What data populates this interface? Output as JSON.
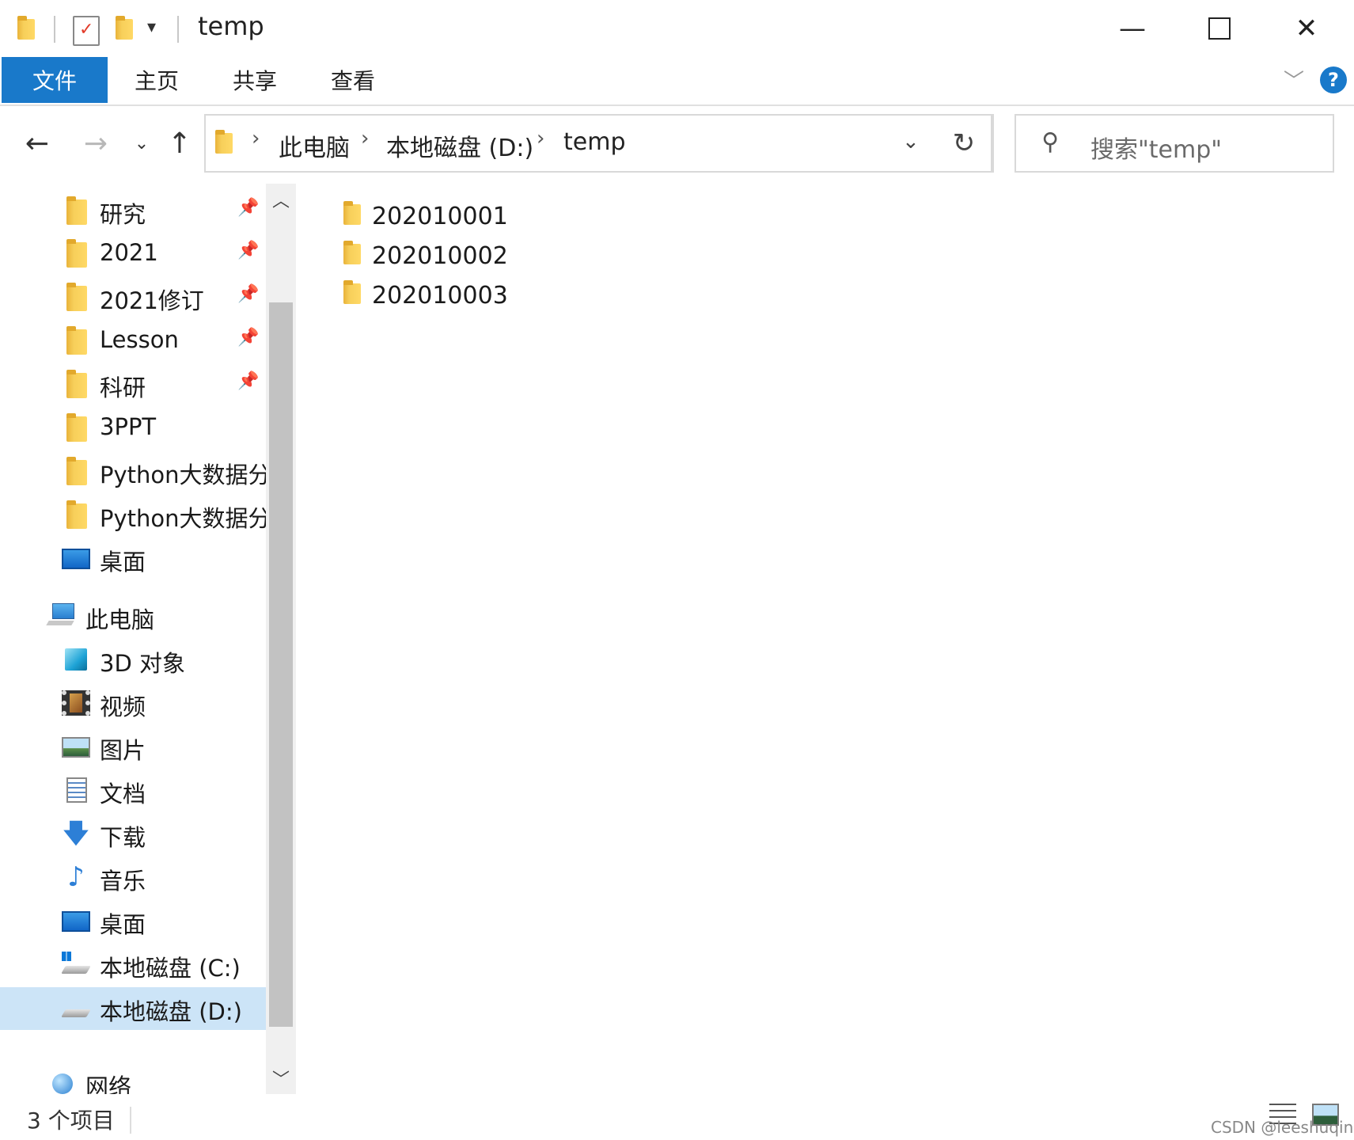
{
  "window": {
    "title": "temp",
    "minimize_glyph": "—",
    "maximize_glyph": "☐",
    "close_glyph": "✕"
  },
  "ribbon": {
    "tabs": [
      "文件",
      "主页",
      "共享",
      "查看"
    ],
    "help_glyph": "?"
  },
  "address": {
    "crumbs": [
      "此电脑",
      "本地磁盘 (D:)",
      "temp"
    ],
    "separator": "›"
  },
  "search": {
    "placeholder": "搜索\"temp\""
  },
  "sidebar": {
    "quick_access": [
      {
        "label": "研究",
        "pinned": true
      },
      {
        "label": "2021",
        "pinned": true
      },
      {
        "label": "2021修订",
        "pinned": true
      },
      {
        "label": "Lesson",
        "pinned": true
      },
      {
        "label": "科研",
        "pinned": true
      },
      {
        "label": "3PPT",
        "pinned": false
      },
      {
        "label": "Python大数据分",
        "pinned": false
      },
      {
        "label": "Python大数据分",
        "pinned": false
      },
      {
        "label": "桌面",
        "pinned": false,
        "icon": "desktop-icon"
      }
    ],
    "this_pc": {
      "label": "此电脑",
      "items": [
        {
          "label": "3D 对象",
          "icon": "3d-objects-icon"
        },
        {
          "label": "视频",
          "icon": "video-icon"
        },
        {
          "label": "图片",
          "icon": "pictures-icon"
        },
        {
          "label": "文档",
          "icon": "documents-icon"
        },
        {
          "label": "下载",
          "icon": "download-icon"
        },
        {
          "label": "音乐",
          "icon": "music-icon"
        },
        {
          "label": "桌面",
          "icon": "desktop-icon"
        },
        {
          "label": "本地磁盘 (C:)",
          "icon": "system-drive-icon"
        },
        {
          "label": "本地磁盘 (D:)",
          "icon": "drive-icon",
          "selected": true
        }
      ]
    },
    "network_label": "网络"
  },
  "content": {
    "items": [
      "202010001",
      "202010002",
      "202010003"
    ]
  },
  "status": {
    "count": "3 个项目",
    "watermark": "CSDN @leeshuqing"
  },
  "colors": {
    "file_tab_bg": "#1979ca",
    "selected_bg": "#cce4f7",
    "folder_yellow": "#f7cf5a",
    "help_blue": "#1979ca"
  }
}
